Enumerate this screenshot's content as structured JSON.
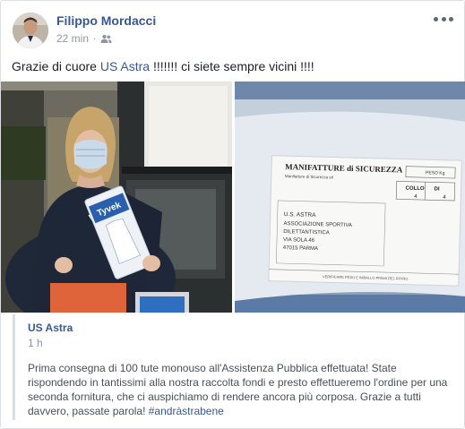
{
  "post": {
    "author": "Filippo Mordacci",
    "time": "22 min",
    "separator": "·",
    "audience_icon": "friends-icon",
    "more_icon": "more-options-icon",
    "text_prefix": "Grazie di cuore ",
    "text_link": "US Astra",
    "text_suffix": " !!!!!!! ci siete sempre vicini !!!!"
  },
  "photos": {
    "left_label_package": "Tyvek",
    "right_label_company": "MANIFATTURE di SICUREZZA",
    "right_label_company_sub": "Manifatture di Sicurezza srl",
    "right_label_pesokg": "PESO Kg",
    "right_label_collo": "COLLO",
    "right_label_di": "DI",
    "right_label_collo_n": "4",
    "right_label_di_n": "4",
    "right_addr_1": "U.S. ASTRA",
    "right_addr_2": "ASSOCIAZIONE SPORTIVA",
    "right_addr_3": "DILETTANTISTICA",
    "right_addr_4": "VIA SOLA 46",
    "right_addr_5": "47015 PARMA",
    "right_footer": "VERIFICARE PESO E IMBALLO PRIMA DEL RITIRO"
  },
  "shared": {
    "name": "US Astra",
    "time": "1 h",
    "body": "Prima consegna di 100 tute monouso all'Assistenza Pubblica effettuata! State rispondendo in tantissimi alla nostra raccolta fondi e presto effettueremo l'ordine per una seconda fornitura, che ci auspichiamo di rendere ancora più corposa. Grazie a tutti davvero, passate parola! ",
    "hashtag": "#andràstrabene"
  },
  "colors": {
    "link": "#365899",
    "meta": "#90949c",
    "text": "#1c1e21"
  }
}
